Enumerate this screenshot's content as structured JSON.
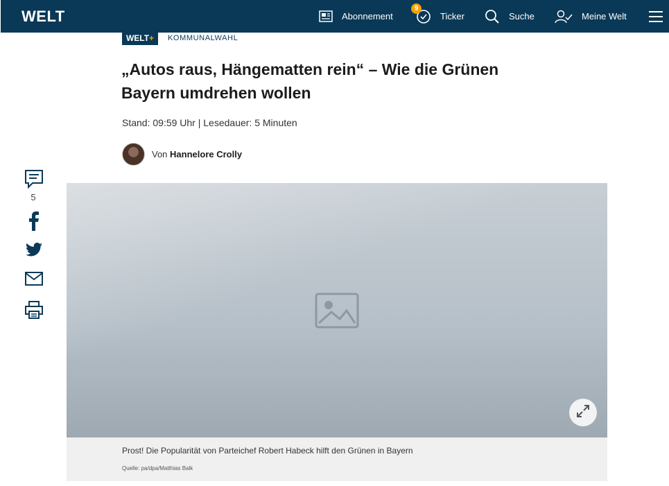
{
  "header": {
    "logo": "WELT",
    "nav": [
      {
        "label": "Abonnement",
        "icon": "newspaper-icon"
      },
      {
        "label": "Ticker",
        "icon": "clock-check-icon",
        "badge": "9"
      },
      {
        "label": "Suche",
        "icon": "search-icon"
      },
      {
        "label": "Meine Welt",
        "icon": "user-check-icon"
      },
      {
        "label": "",
        "icon": "hamburger-menu-icon"
      }
    ],
    "colors": {
      "bar": "#0a3957",
      "badge": "#f5a100"
    }
  },
  "rail": {
    "comments_count": "5",
    "buttons": [
      "comment-icon",
      "facebook-icon",
      "twitter-icon",
      "mail-icon",
      "print-icon"
    ]
  },
  "article": {
    "plus_badge": {
      "text": "WELT",
      "plus": "+"
    },
    "kicker": "KOMMUNALWAHL",
    "headline": "„Autos raus, Hängematten rein“ – Wie die Grünen Bayern umdrehen wollen",
    "meta": "Stand: 09:59 Uhr | Lesedauer: 5 Minuten",
    "byline_prefix": "Von",
    "author": "Hannelore Crolly",
    "image": {
      "caption": "Prost! Die Popularität von Parteichef Robert Habeck hilft den Grünen in Bayern",
      "source": "Quelle: pa/dpa/Matthias Balk"
    }
  }
}
